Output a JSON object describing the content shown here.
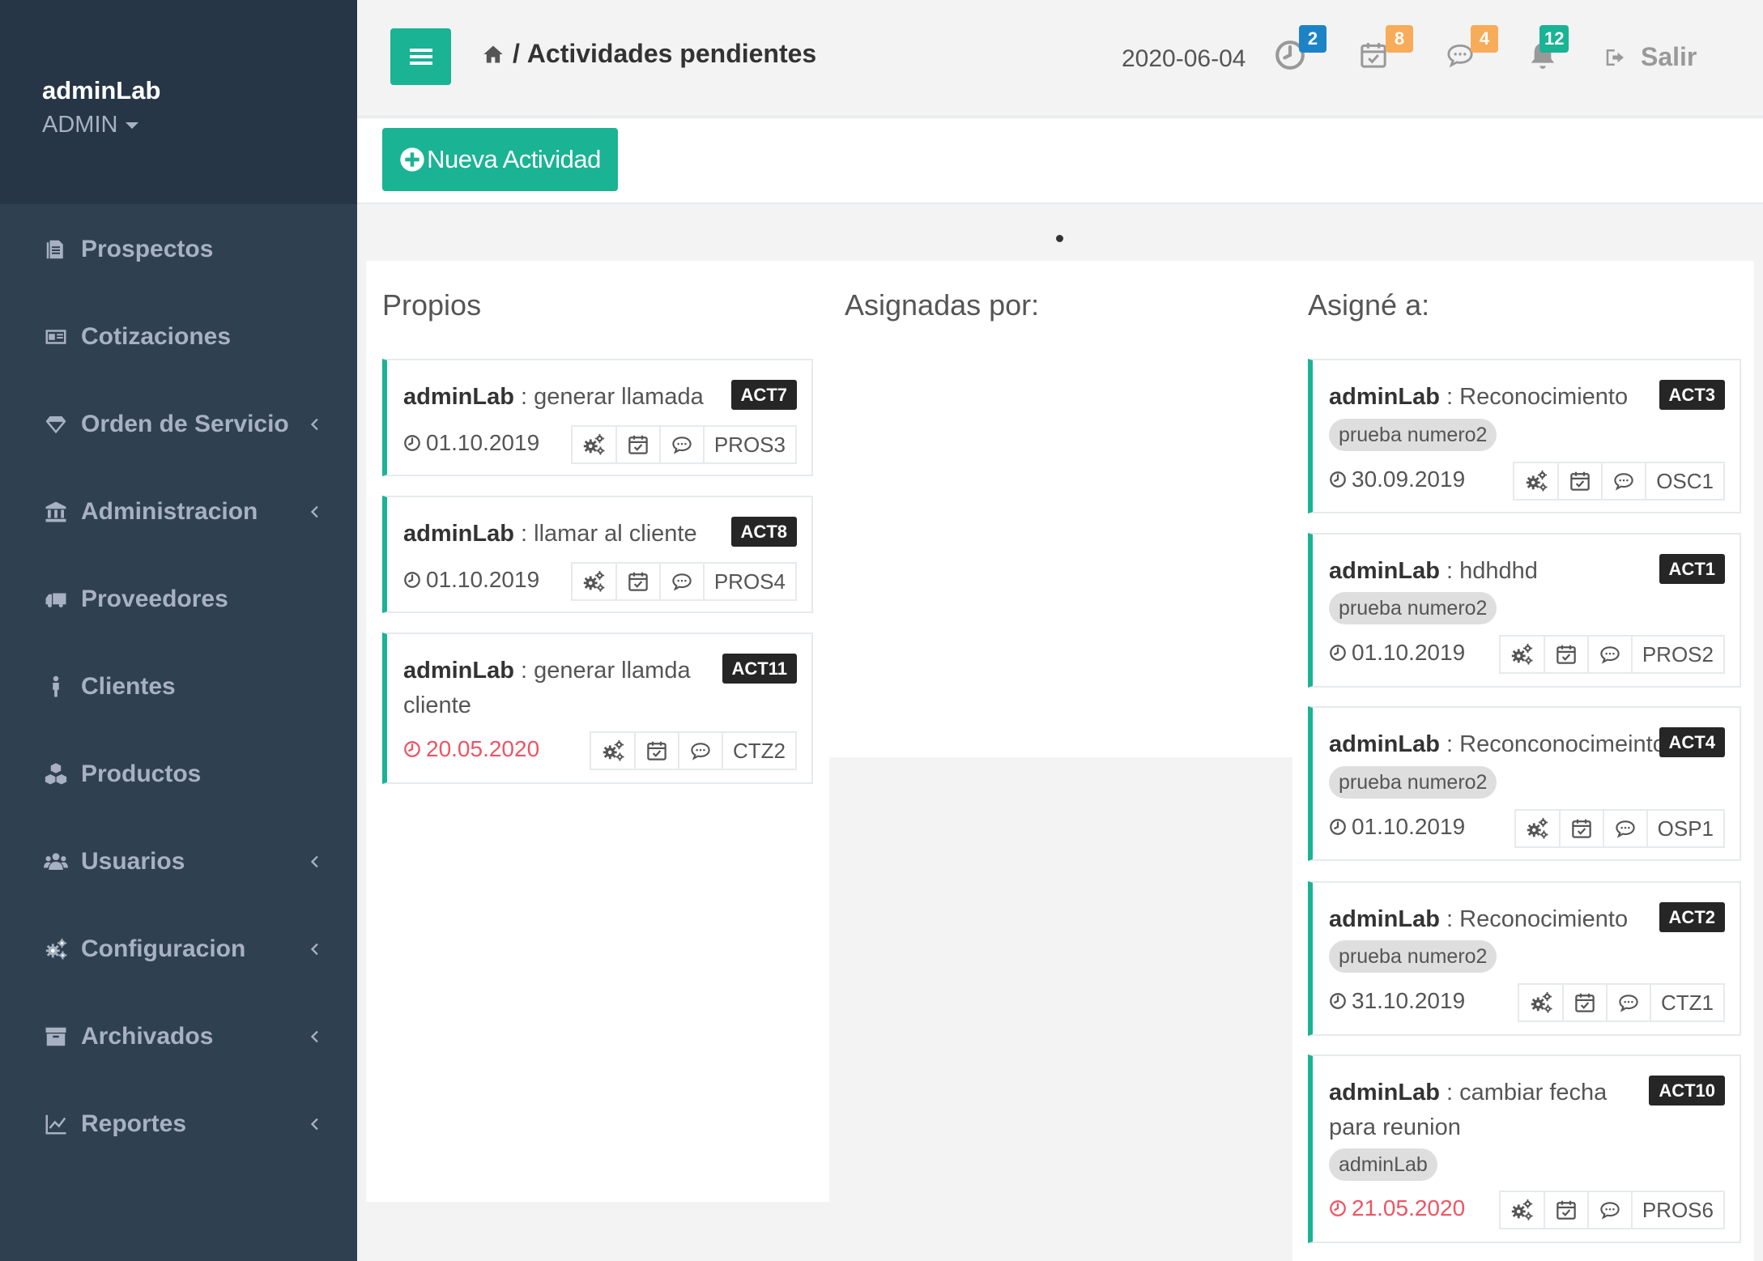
{
  "user": {
    "name": "adminLab",
    "role": "ADMIN"
  },
  "sidebar": {
    "items": [
      {
        "label": "Prospectos",
        "icon": "document-icon",
        "has_arrow": false
      },
      {
        "label": "Cotizaciones",
        "icon": "id-card-icon",
        "has_arrow": false
      },
      {
        "label": "Orden de Servicio",
        "icon": "diamond-icon",
        "has_arrow": true
      },
      {
        "label": "Administracion",
        "icon": "bank-icon",
        "has_arrow": true
      },
      {
        "label": "Proveedores",
        "icon": "truck-icon",
        "has_arrow": false
      },
      {
        "label": "Clientes",
        "icon": "person-icon",
        "has_arrow": false
      },
      {
        "label": "Productos",
        "icon": "cubes-icon",
        "has_arrow": false
      },
      {
        "label": "Usuarios",
        "icon": "users-icon",
        "has_arrow": true
      },
      {
        "label": "Configuracion",
        "icon": "gears-icon",
        "has_arrow": true
      },
      {
        "label": "Archivados",
        "icon": "archive-icon",
        "has_arrow": true
      },
      {
        "label": "Reportes",
        "icon": "line-chart-icon",
        "has_arrow": true
      }
    ]
  },
  "header": {
    "separator": "/",
    "title": "Actividades pendientes",
    "date": "2020-06-04",
    "notifications": [
      {
        "icon": "clock-icon",
        "count": "2",
        "color": "#1c84c6"
      },
      {
        "icon": "calendar-check-icon",
        "count": "8",
        "color": "#f8ac59"
      },
      {
        "icon": "comments-icon",
        "count": "4",
        "color": "#f8ac59"
      },
      {
        "icon": "bell-icon",
        "count": "12",
        "color": "#1ab394"
      }
    ],
    "logout_label": "Salir"
  },
  "toolbar": {
    "new_label": "Nueva Actividad"
  },
  "colors": {
    "accent": "#1ab394",
    "sidebar": "#2f4050",
    "overdue": "#ed5565"
  },
  "columns": {
    "propios": {
      "title": "Propios",
      "cards": [
        {
          "user": "adminLab",
          "sep": " : ",
          "text": "generar llamada",
          "code": "ACT7",
          "date": "01.10.2019",
          "overdue": false,
          "ref": "PROS3"
        },
        {
          "user": "adminLab",
          "sep": " : ",
          "text": "llamar al cliente",
          "code": "ACT8",
          "date": "01.10.2019",
          "overdue": false,
          "ref": "PROS4"
        },
        {
          "user": "adminLab",
          "sep": " : ",
          "text": "generar llamda cliente",
          "code": "ACT11",
          "date": "20.05.2020",
          "overdue": true,
          "ref": "CTZ2"
        }
      ]
    },
    "asignadas": {
      "title": "Asignadas por:"
    },
    "asigne": {
      "title": "Asigné a:",
      "cards": [
        {
          "user": "adminLab",
          "sep": " : ",
          "text": "Reconocimiento",
          "code": "ACT3",
          "tag": "prueba numero2",
          "date": "30.09.2019",
          "overdue": false,
          "ref": "OSC1"
        },
        {
          "user": "adminLab",
          "sep": " : ",
          "text": "hdhdhd",
          "code": "ACT1",
          "tag": "prueba numero2",
          "date": "01.10.2019",
          "overdue": false,
          "ref": "PROS2"
        },
        {
          "user": "adminLab",
          "sep": " : ",
          "text": "Reconconocimeinto",
          "code": "ACT4",
          "tag": "prueba numero2",
          "date": "01.10.2019",
          "overdue": false,
          "ref": "OSP1"
        },
        {
          "user": "adminLab",
          "sep": " : ",
          "text": "Reconocimiento",
          "code": "ACT2",
          "tag": "prueba numero2",
          "date": "31.10.2019",
          "overdue": false,
          "ref": "CTZ1"
        },
        {
          "user": "adminLab",
          "sep": " : ",
          "text": "cambiar fecha para reunion",
          "code": "ACT10",
          "tag": "adminLab",
          "date": "21.05.2020",
          "overdue": true,
          "ref": "PROS6"
        }
      ]
    }
  }
}
